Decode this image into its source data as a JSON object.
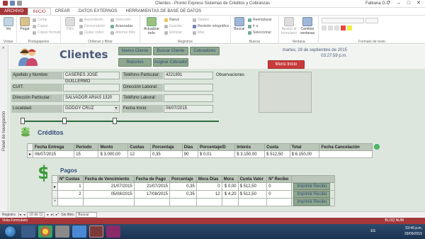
{
  "window": {
    "title": "Clientes - Pronto Express Sistemas de Créditos y Cobranzas",
    "user": "Fabiana G.C",
    "help": "?",
    "min": "–",
    "max": "□",
    "close": "✕"
  },
  "ribbon_tabs": [
    "ARCHIVO",
    "INICIO",
    "CREAR",
    "DATOS EXTERNOS",
    "HERRAMIENTAS DE BASE DE DATOS"
  ],
  "ribbon": {
    "vistas": {
      "group": "Vistas",
      "ver": "Ver"
    },
    "portapapeles": {
      "group": "Portapapeles",
      "pegar": "Pegar",
      "cortar": "Cortar",
      "copiar": "Copiar",
      "copiar_formato": "Copiar formato"
    },
    "ordenar": {
      "group": "Ordenar y filtrar",
      "filtro": "Filtro",
      "ascendente": "Ascendente",
      "descendente": "Descendente",
      "quitar_orden": "Quitar orden",
      "seleccion": "Selección",
      "avanzadas": "Avanzadas",
      "alternar_filtro": "Alternar filtro"
    },
    "registros": {
      "group": "Registros",
      "actualizar": "Actualizar todo",
      "nuevo": "Nuevo",
      "guardar": "Guardar",
      "eliminar": "Eliminar",
      "totales": "Totales",
      "revision": "Revisión ortográfica",
      "mas": "Más"
    },
    "buscar": {
      "group": "Buscar",
      "buscar": "Buscar",
      "reemplazar": "Reemplazar",
      "ir_a": "Ir a",
      "seleccionar": "Seleccionar"
    },
    "ventana": {
      "group": "Ventana",
      "ajustar": "Ajustar al formulario",
      "cambiar": "Cambiar ventanas"
    },
    "formato": {
      "group": "Formato de texto"
    }
  },
  "nav_pane": {
    "label": "Panel de navegación",
    "arrow": "»"
  },
  "form": {
    "title": "Clientes",
    "buttons": {
      "nuevo_cliente": "Nuevo Cliente",
      "buscar_cliente": "Buscar Cliente",
      "cobradores": "Cobradores",
      "reportes": "Reportes",
      "asignar_cobrador": "Asignar Cobrador",
      "menu_inicio": "Menú Inicio"
    },
    "date": "martes, 29 de septiembre de 2015",
    "time": "03:27:59 p.m.",
    "fields": {
      "apellido_label": "Apellido y Nombre:",
      "apellido_value": "CASERES JOSE GUILLERMO",
      "tel_part_label": "Teléfono Particular:",
      "tel_part_value": "4221891",
      "obs_label": "Observaciones",
      "cuit_label": "CUIT:",
      "cuit_value": "",
      "dir_lab_label": "Dirección Laboral:",
      "dir_lab_value": "",
      "dir_part_label": "Dirección Particular:",
      "dir_part_value": "SALVADOR ARIAS 1320",
      "tel_lab_label": "Teléfono Laboral:",
      "tel_lab_value": "",
      "localidad_label": "Localidad:",
      "localidad_value": "GODOY CRUZ",
      "fecha_inicio_label": "Fecha Inicio:",
      "fecha_inicio_value": "06/07/2015"
    }
  },
  "creditos": {
    "title": "Créditos",
    "headers": [
      "Fecha Entrega",
      "Periodo",
      "Monto",
      "Cuotas",
      "Porcentaje",
      "Días",
      "Porcentaje/D",
      "Interés",
      "Cuota",
      "Total",
      "Fecha Cancelación"
    ],
    "row": [
      "06/07/2015",
      "15",
      "$ 3.000,00",
      "12",
      "0,35",
      "90",
      "$ 0,01",
      "$ 3.150,00",
      "$ 512,50",
      "$ 6.150,00",
      ""
    ],
    "row_marker": "▸"
  },
  "pagos": {
    "title": "Pagos",
    "headers": [
      "Nº Cuotas",
      "Fecha de Vencimiento",
      "Fecha de Pago",
      "Porcentaje",
      "Mora Días",
      "Mora",
      "Cuota Valor",
      "Nº Recibo"
    ],
    "rows": [
      [
        "1",
        "21/07/2015",
        "21/07/2015",
        "0,35",
        "0",
        "$ 0,00",
        "$ 512,50",
        "0"
      ],
      [
        "2",
        "05/08/2015",
        "17/08/2015",
        "0,35",
        "12",
        "$ 4,20",
        "$ 512,50",
        "0"
      ]
    ],
    "new_row_marker": "*",
    "print_label": "Imprimir Recibo"
  },
  "record_nav": {
    "label": "Registro:",
    "position": "10 de 11",
    "filter": "Sin filtro",
    "search": "Buscar"
  },
  "status": {
    "left": "Vista Formulario",
    "right": "BLOQ NUM"
  },
  "taskbar": {
    "lang": "ES",
    "time": "03:40 p.m.",
    "date": "29/09/2015"
  }
}
